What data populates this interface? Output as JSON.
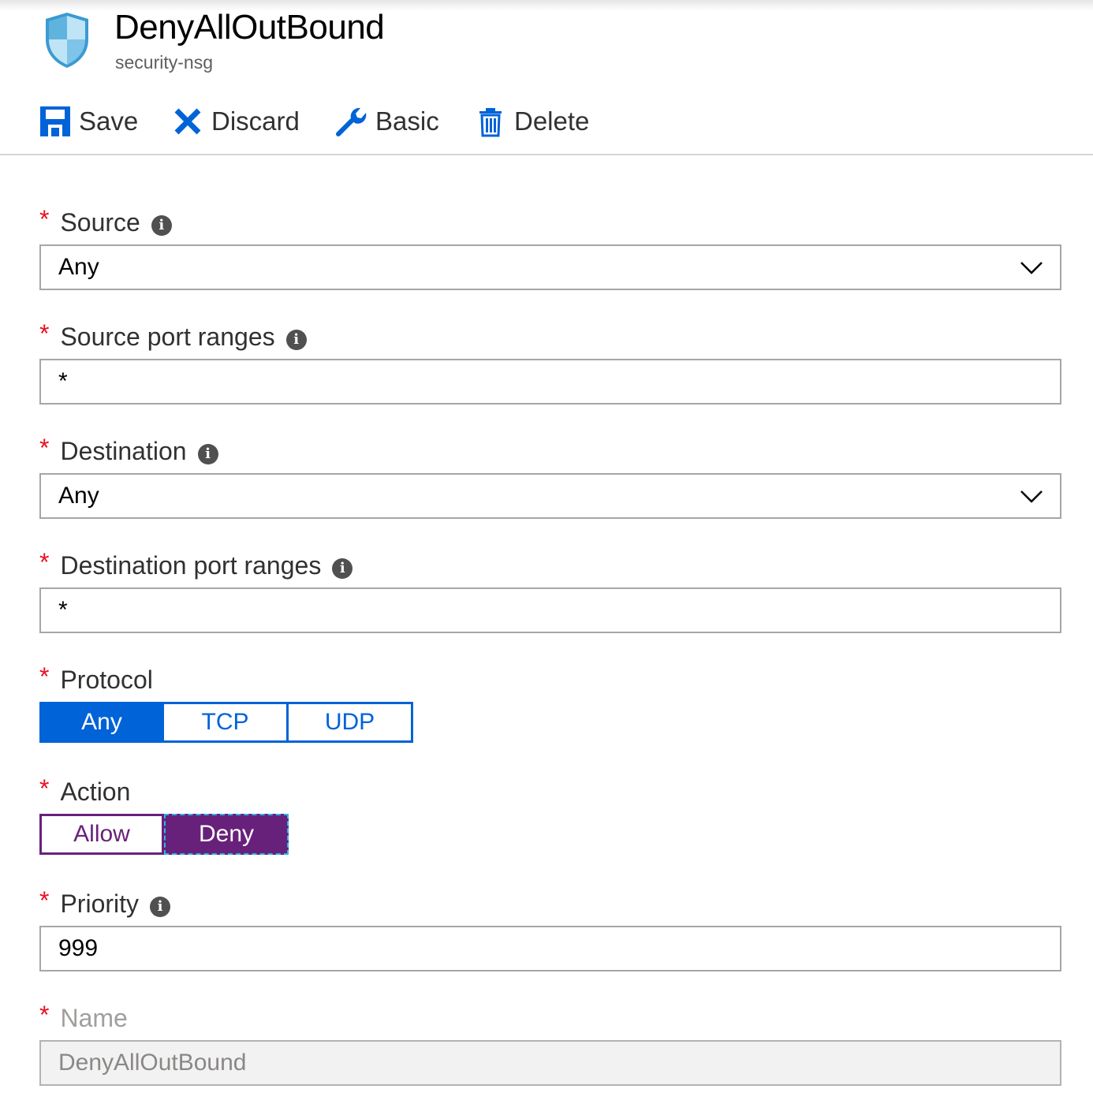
{
  "header": {
    "title": "DenyAllOutBound",
    "subtitle": "security-nsg",
    "icon": "shield-icon"
  },
  "toolbar": {
    "save_label": "Save",
    "discard_label": "Discard",
    "basic_label": "Basic",
    "delete_label": "Delete"
  },
  "fields": {
    "source": {
      "label": "Source",
      "value": "Any"
    },
    "source_ports": {
      "label": "Source port ranges",
      "value": "*"
    },
    "destination": {
      "label": "Destination",
      "value": "Any"
    },
    "destination_ports": {
      "label": "Destination port ranges",
      "value": "*"
    },
    "protocol": {
      "label": "Protocol",
      "options": [
        "Any",
        "TCP",
        "UDP"
      ],
      "selected": "Any"
    },
    "action": {
      "label": "Action",
      "options": [
        "Allow",
        "Deny"
      ],
      "selected": "Deny"
    },
    "priority": {
      "label": "Priority",
      "value": "999"
    },
    "name": {
      "label": "Name",
      "value": "DenyAllOutBound"
    }
  },
  "required_marker": "*",
  "colors": {
    "accent": "#0063d8",
    "action_accent": "#68217a",
    "required": "#e81123",
    "focus_outline": "#2ab7e8"
  }
}
